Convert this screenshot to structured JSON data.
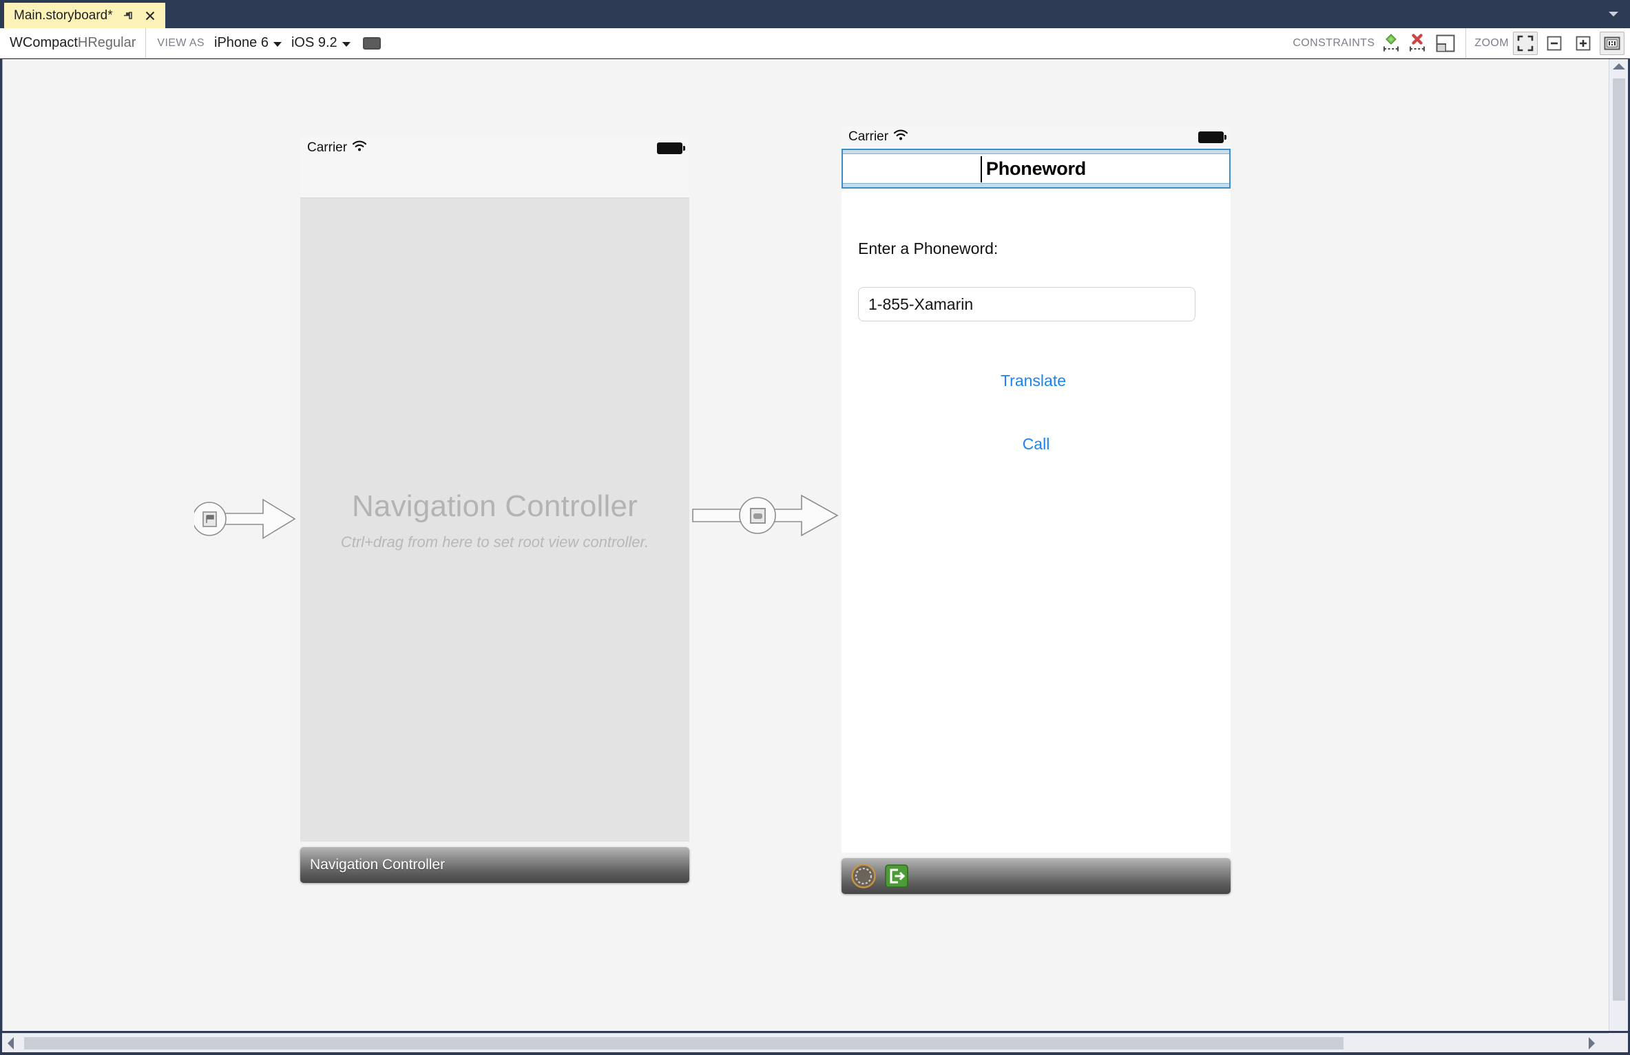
{
  "window": {
    "tab": {
      "title": "Main.storyboard*",
      "pin_icon": "pin-icon",
      "close_icon": "close-icon"
    },
    "tabstrip_caret_icon": "chevron-down-icon"
  },
  "toolbar": {
    "size_class_w": "WCompact ",
    "size_class_h": "HRegular",
    "view_as_caption": "VIEW AS",
    "device_value": "iPhone 6",
    "os_value": "iOS 9.2",
    "orientation_icon": "device-orientation-icon",
    "constraints_caption": "CONSTRAINTS",
    "constraints_add_icon": "add-constraints-icon",
    "constraints_clear_icon": "clear-constraints-icon",
    "constraints_frame_icon": "update-frames-icon",
    "zoom_caption": "ZOOM",
    "zoom_fit_icon": "zoom-to-fit-icon",
    "zoom_out_icon": "zoom-out-icon",
    "zoom_in_icon": "zoom-in-icon",
    "zoom_actual_icon": "zoom-actual-size-icon"
  },
  "canvas": {
    "background_color": "#f4f4f4",
    "scenes": [
      {
        "id": "navigation-controller",
        "dock_title": "Navigation Controller",
        "status_bar": {
          "carrier": "Carrier",
          "wifi_icon": "wifi-icon",
          "battery_icon": "battery-icon"
        },
        "placeholder_title": "Navigation Controller",
        "placeholder_subtitle": "Ctrl+drag from here to set root view controller."
      },
      {
        "id": "phoneword-view-controller",
        "status_bar": {
          "carrier": "Carrier",
          "wifi_icon": "wifi-icon",
          "battery_icon": "battery-icon"
        },
        "navbar_title": "Phoneword",
        "navbar_state": "selected-editing",
        "label_enter": "Enter a Phoneword:",
        "textfield_value": "1-855-Xamarin",
        "textfield_placeholder": "",
        "button_translate": "Translate",
        "button_call": "Call",
        "dock_icons": [
          {
            "name": "view-controller-icon"
          },
          {
            "name": "exit-segue-icon"
          }
        ]
      }
    ],
    "connectors": [
      {
        "name": "initial-view-controller-entry-point",
        "icon": "storyboard-entry-flag-icon"
      },
      {
        "name": "root-view-controller-relationship-segue",
        "icon": "view-controller-icon"
      }
    ]
  },
  "scrollbars": {
    "vertical": {
      "up_arrow_icon": "scroll-up-icon"
    },
    "horizontal": {
      "left_arrow_icon": "scroll-left-icon",
      "right_arrow_icon": "scroll-right-icon"
    }
  },
  "colors": {
    "window_chrome": "#2e3b55",
    "active_tab": "#fdf3b8",
    "selection_blue": "#3a8fc8",
    "ios_blue": "#1a84f0",
    "constraint_add_green": "#6ebf4b",
    "constraint_clear_red": "#cc4444"
  }
}
